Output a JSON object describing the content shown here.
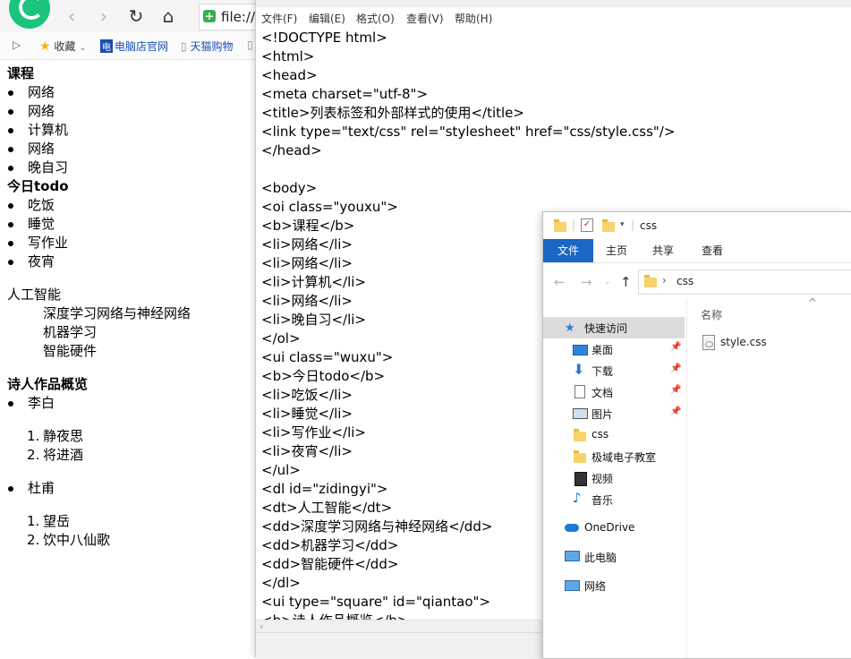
{
  "browser": {
    "url_text": "file:///",
    "bookmarks": [
      {
        "label": "收藏",
        "icon": "star-icon"
      },
      {
        "label": "电脑店官网",
        "icon": "site-icon",
        "tag": "电"
      },
      {
        "label": "天猫购物",
        "icon": "page-icon"
      }
    ],
    "page": {
      "ol_heading": "课程",
      "ol_items": [
        "网络",
        "网络",
        "计算机",
        "网络",
        "晚自习"
      ],
      "ul_heading": "今日todo",
      "ul_items": [
        "吃饭",
        "睡觉",
        "写作业",
        "夜宵"
      ],
      "dl_term": "人工智能",
      "dl_defs": [
        "深度学习网络与神经网络",
        "机器学习",
        "智能硬件"
      ],
      "nested_heading": "诗人作品概览",
      "poets": [
        {
          "name": "李白",
          "works": [
            {
              "n": "1.",
              "t": "静夜思"
            },
            {
              "n": "2.",
              "t": "将进酒"
            }
          ]
        },
        {
          "name": "杜甫",
          "works": [
            {
              "n": "1.",
              "t": "望岳"
            },
            {
              "n": "2.",
              "t": "饮中八仙歌"
            }
          ]
        }
      ]
    }
  },
  "notepad": {
    "menu": [
      "文件(F)",
      "编辑(E)",
      "格式(O)",
      "查看(V)",
      "帮助(H)"
    ],
    "lines": [
      "<!DOCTYPE html>",
      "<html>",
      "<head>",
      "<meta charset=\"utf-8\">",
      "<title>列表标签和外部样式的使用</title>",
      "<link type=\"text/css\" rel=\"stylesheet\" href=\"css/style.css\"/>",
      "</head>",
      "",
      "<body>",
      "<oi class=\"youxu\">",
      "<b>课程</b>",
      "<li>网络</li>",
      "<li>网络</li>",
      "<li>计算机</li>",
      "<li>网络</li>",
      "<li>晚自习</li>",
      "</ol>",
      "<ui class=\"wuxu\">",
      "<b>今日todo</b>",
      "<li>吃饭</li>",
      "<li>睡觉</li>",
      "<li>写作业</li>",
      "<li>夜宵</li>",
      "</ul>",
      "<dl id=\"zidingyi\">",
      "<dt>人工智能</dt>",
      "<dd>深度学习网络与神经网络</dd>",
      "<dd>机器学习</dd>",
      "<dd>智能硬件</dd>",
      "</dl>",
      "<ui type=\"square\" id=\"qiantao\">",
      "<b>诗人作品概览</b>"
    ]
  },
  "explorer": {
    "title": "css",
    "ribbon_tabs": [
      "文件",
      "主页",
      "共享",
      "查看"
    ],
    "address": "css",
    "column_header": "名称",
    "nav_items": [
      {
        "label": "快速访问",
        "icon": "star-icon",
        "selected": true
      },
      {
        "label": "桌面",
        "icon": "desktop-icon",
        "pinned": true
      },
      {
        "label": "下载",
        "icon": "download-icon",
        "pinned": true
      },
      {
        "label": "文档",
        "icon": "document-icon",
        "pinned": true
      },
      {
        "label": "图片",
        "icon": "picture-icon",
        "pinned": true
      },
      {
        "label": "css",
        "icon": "folder-icon"
      },
      {
        "label": "极域电子教室",
        "icon": "folder-icon"
      },
      {
        "label": "视频",
        "icon": "video-icon"
      },
      {
        "label": "音乐",
        "icon": "music-icon"
      },
      {
        "label": "OneDrive",
        "icon": "cloud-icon"
      },
      {
        "label": "此电脑",
        "icon": "computer-icon"
      },
      {
        "label": "网络",
        "icon": "network-icon"
      }
    ],
    "files": [
      {
        "name": "style.css",
        "icon": "css-file-icon"
      }
    ]
  }
}
